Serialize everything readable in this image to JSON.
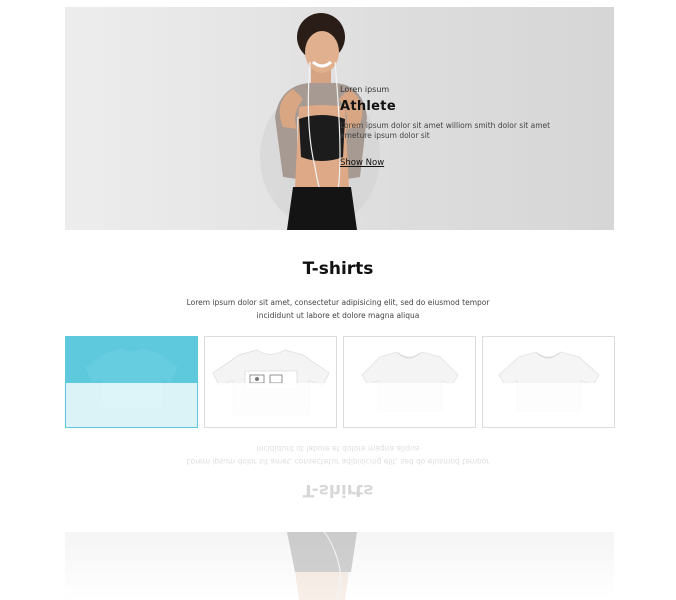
{
  "hero": {
    "eyebrow": "Loren ipsum",
    "title": "Athlete",
    "text": "Lorem ipsum dolor sit amet williom smith dolor sit amet ameture ipsum dolor sit",
    "link_label": "Show Now"
  },
  "section": {
    "title": "T-shirts",
    "description": "Lorem ipsum dolor sit amet, consectetur adipisicing elit, sed do eiusmod tempor incididunt ut labore et dolore magna aliqua"
  },
  "products": [
    {
      "name": "t-shirt-1",
      "selected": true,
      "accent": "#5ec8dc"
    },
    {
      "name": "t-shirt-2",
      "selected": false,
      "has_print": true
    },
    {
      "name": "t-shirt-3",
      "selected": false
    },
    {
      "name": "t-shirt-4",
      "selected": false
    }
  ],
  "colors": {
    "accent": "#5ec8dc",
    "hero_bg": "#e3e3e3",
    "text": "#111111"
  }
}
